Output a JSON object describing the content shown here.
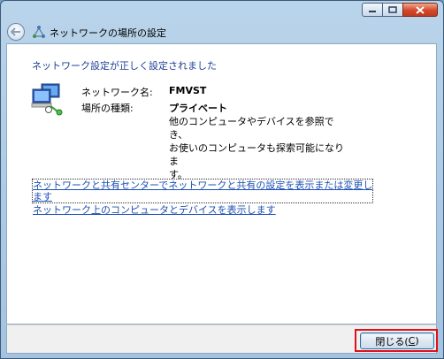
{
  "window": {
    "title": "ネットワークの場所の設定",
    "controls": [
      "minimize-icon",
      "maximize-icon",
      "close-icon"
    ]
  },
  "content": {
    "heading": "ネットワーク設定が正しく設定されました",
    "network_name_label": "ネットワーク名:",
    "network_name_value": "FMVST",
    "location_type_label": "場所の種類:",
    "location_type_value": "プライベート",
    "description_line1": "他のコンピュータやデバイスを参照でき、",
    "description_line2": "お使いのコンピュータも探索可能になりま",
    "description_line3": "す。",
    "link_sharing_center_line1": "ネットワークと共有センターでネットワークと共有の設定を表示または変更し",
    "link_sharing_center_line2": "ます",
    "link_view_devices": "ネットワーク上のコンピュータとデバイスを表示します"
  },
  "footer": {
    "close_button_label": "閉じる(",
    "close_button_mnemonic": "C",
    "close_button_suffix": ")"
  },
  "colors": {
    "heading_blue": "#1c3f94",
    "link_blue": "#1c50b4",
    "highlight_red": "#e0101a"
  }
}
